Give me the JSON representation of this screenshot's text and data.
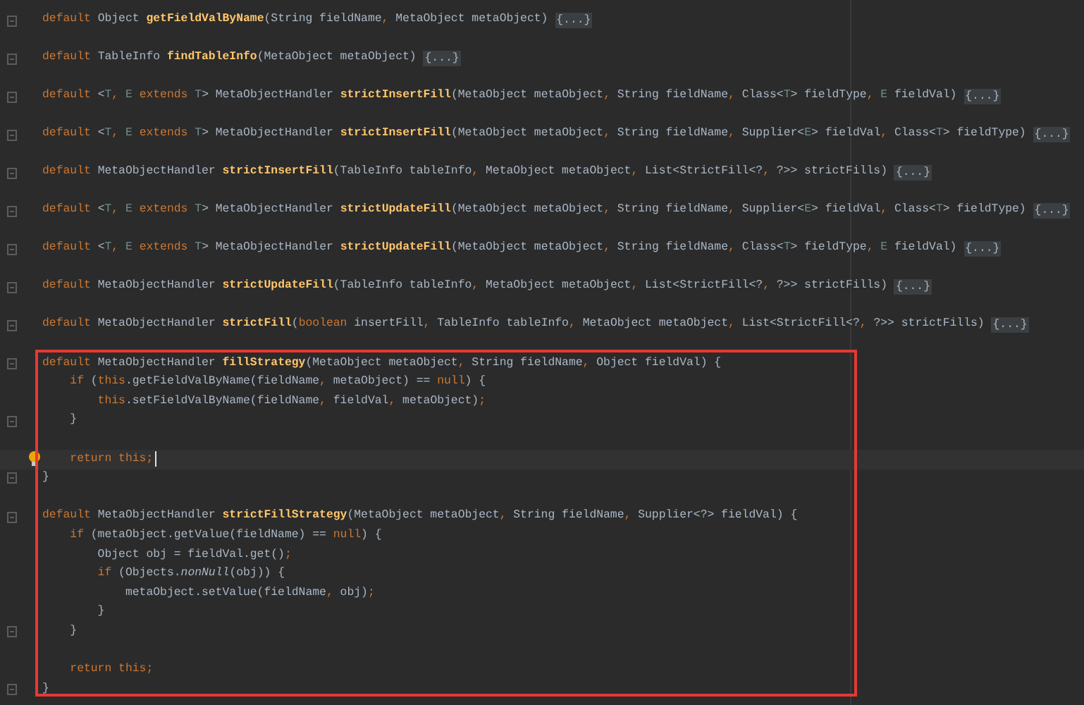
{
  "folded_methods": [
    {
      "tokens": [
        {
          "kind": "kw",
          "text": "default"
        },
        {
          "kind": "tx",
          "text": " Object "
        },
        {
          "kind": "fn",
          "text": "getFieldValByName"
        },
        {
          "kind": "tx",
          "text": "(String fieldName"
        },
        {
          "kind": "kw",
          "text": ","
        },
        {
          "kind": "tx",
          "text": " MetaObject metaObject)"
        }
      ],
      "folded": "{...}"
    },
    {
      "tokens": [
        {
          "kind": "kw",
          "text": "default"
        },
        {
          "kind": "tx",
          "text": " TableInfo "
        },
        {
          "kind": "fn",
          "text": "findTableInfo"
        },
        {
          "kind": "tx",
          "text": "(MetaObject metaObject)"
        }
      ],
      "folded": "{...}"
    },
    {
      "tokens": [
        {
          "kind": "kw",
          "text": "default"
        },
        {
          "kind": "tx",
          "text": " <"
        },
        {
          "kind": "tp",
          "text": "T"
        },
        {
          "kind": "kw",
          "text": ","
        },
        {
          "kind": "tp",
          "text": " E"
        },
        {
          "kind": "kw",
          "text": " extends "
        },
        {
          "kind": "tp",
          "text": "T"
        },
        {
          "kind": "tx",
          "text": "> MetaObjectHandler "
        },
        {
          "kind": "fn",
          "text": "strictInsertFill"
        },
        {
          "kind": "tx",
          "text": "(MetaObject metaObject"
        },
        {
          "kind": "kw",
          "text": ","
        },
        {
          "kind": "tx",
          "text": " String fieldName"
        },
        {
          "kind": "kw",
          "text": ","
        },
        {
          "kind": "tx",
          "text": " Class<"
        },
        {
          "kind": "tp",
          "text": "T"
        },
        {
          "kind": "tx",
          "text": "> fieldType"
        },
        {
          "kind": "kw",
          "text": ","
        },
        {
          "kind": "tp",
          "text": " E"
        },
        {
          "kind": "tx",
          "text": " fieldVal)"
        }
      ],
      "folded": "{...}"
    },
    {
      "tokens": [
        {
          "kind": "kw",
          "text": "default"
        },
        {
          "kind": "tx",
          "text": " <"
        },
        {
          "kind": "tp",
          "text": "T"
        },
        {
          "kind": "kw",
          "text": ","
        },
        {
          "kind": "tp",
          "text": " E"
        },
        {
          "kind": "kw",
          "text": " extends "
        },
        {
          "kind": "tp",
          "text": "T"
        },
        {
          "kind": "tx",
          "text": "> MetaObjectHandler "
        },
        {
          "kind": "fn",
          "text": "strictInsertFill"
        },
        {
          "kind": "tx",
          "text": "(MetaObject metaObject"
        },
        {
          "kind": "kw",
          "text": ","
        },
        {
          "kind": "tx",
          "text": " String fieldName"
        },
        {
          "kind": "kw",
          "text": ","
        },
        {
          "kind": "tx",
          "text": " Supplier<"
        },
        {
          "kind": "tp",
          "text": "E"
        },
        {
          "kind": "tx",
          "text": "> fieldVal"
        },
        {
          "kind": "kw",
          "text": ","
        },
        {
          "kind": "tx",
          "text": " Class<"
        },
        {
          "kind": "tp",
          "text": "T"
        },
        {
          "kind": "tx",
          "text": "> fieldType)"
        }
      ],
      "folded": "{...}"
    },
    {
      "tokens": [
        {
          "kind": "kw",
          "text": "default"
        },
        {
          "kind": "tx",
          "text": " MetaObjectHandler "
        },
        {
          "kind": "fn",
          "text": "strictInsertFill"
        },
        {
          "kind": "tx",
          "text": "(TableInfo tableInfo"
        },
        {
          "kind": "kw",
          "text": ","
        },
        {
          "kind": "tx",
          "text": " MetaObject metaObject"
        },
        {
          "kind": "kw",
          "text": ","
        },
        {
          "kind": "tx",
          "text": " List<StrictFill<?"
        },
        {
          "kind": "kw",
          "text": ","
        },
        {
          "kind": "tx",
          "text": " ?>> strictFills)"
        }
      ],
      "folded": "{...}"
    },
    {
      "tokens": [
        {
          "kind": "kw",
          "text": "default"
        },
        {
          "kind": "tx",
          "text": " <"
        },
        {
          "kind": "tp",
          "text": "T"
        },
        {
          "kind": "kw",
          "text": ","
        },
        {
          "kind": "tp",
          "text": " E"
        },
        {
          "kind": "kw",
          "text": " extends "
        },
        {
          "kind": "tp",
          "text": "T"
        },
        {
          "kind": "tx",
          "text": "> MetaObjectHandler "
        },
        {
          "kind": "fn",
          "text": "strictUpdateFill"
        },
        {
          "kind": "tx",
          "text": "(MetaObject metaObject"
        },
        {
          "kind": "kw",
          "text": ","
        },
        {
          "kind": "tx",
          "text": " String fieldName"
        },
        {
          "kind": "kw",
          "text": ","
        },
        {
          "kind": "tx",
          "text": " Supplier<"
        },
        {
          "kind": "tp",
          "text": "E"
        },
        {
          "kind": "tx",
          "text": "> fieldVal"
        },
        {
          "kind": "kw",
          "text": ","
        },
        {
          "kind": "tx",
          "text": " Class<"
        },
        {
          "kind": "tp",
          "text": "T"
        },
        {
          "kind": "tx",
          "text": "> fieldType)"
        }
      ],
      "folded": "{...}"
    },
    {
      "tokens": [
        {
          "kind": "kw",
          "text": "default"
        },
        {
          "kind": "tx",
          "text": " <"
        },
        {
          "kind": "tp",
          "text": "T"
        },
        {
          "kind": "kw",
          "text": ","
        },
        {
          "kind": "tp",
          "text": " E"
        },
        {
          "kind": "kw",
          "text": " extends "
        },
        {
          "kind": "tp",
          "text": "T"
        },
        {
          "kind": "tx",
          "text": "> MetaObjectHandler "
        },
        {
          "kind": "fn",
          "text": "strictUpdateFill"
        },
        {
          "kind": "tx",
          "text": "(MetaObject metaObject"
        },
        {
          "kind": "kw",
          "text": ","
        },
        {
          "kind": "tx",
          "text": " String fieldName"
        },
        {
          "kind": "kw",
          "text": ","
        },
        {
          "kind": "tx",
          "text": " Class<"
        },
        {
          "kind": "tp",
          "text": "T"
        },
        {
          "kind": "tx",
          "text": "> fieldType"
        },
        {
          "kind": "kw",
          "text": ","
        },
        {
          "kind": "tp",
          "text": " E"
        },
        {
          "kind": "tx",
          "text": " fieldVal)"
        }
      ],
      "folded": "{...}"
    },
    {
      "tokens": [
        {
          "kind": "kw",
          "text": "default"
        },
        {
          "kind": "tx",
          "text": " MetaObjectHandler "
        },
        {
          "kind": "fn",
          "text": "strictUpdateFill"
        },
        {
          "kind": "tx",
          "text": "(TableInfo tableInfo"
        },
        {
          "kind": "kw",
          "text": ","
        },
        {
          "kind": "tx",
          "text": " MetaObject metaObject"
        },
        {
          "kind": "kw",
          "text": ","
        },
        {
          "kind": "tx",
          "text": " List<StrictFill<?"
        },
        {
          "kind": "kw",
          "text": ","
        },
        {
          "kind": "tx",
          "text": " ?>> strictFills)"
        }
      ],
      "folded": "{...}"
    },
    {
      "tokens": [
        {
          "kind": "kw",
          "text": "default"
        },
        {
          "kind": "tx",
          "text": " MetaObjectHandler "
        },
        {
          "kind": "fn",
          "text": "strictFill"
        },
        {
          "kind": "tx",
          "text": "("
        },
        {
          "kind": "kw",
          "text": "boolean"
        },
        {
          "kind": "tx",
          "text": " insertFill"
        },
        {
          "kind": "kw",
          "text": ","
        },
        {
          "kind": "tx",
          "text": " TableInfo tableInfo"
        },
        {
          "kind": "kw",
          "text": ","
        },
        {
          "kind": "tx",
          "text": " MetaObject metaObject"
        },
        {
          "kind": "kw",
          "text": ","
        },
        {
          "kind": "tx",
          "text": " List<StrictFill<?"
        },
        {
          "kind": "kw",
          "text": ","
        },
        {
          "kind": "tx",
          "text": " ?>> strictFills)"
        }
      ],
      "folded": "{...}"
    }
  ],
  "highlighted_block": [
    {
      "kind": "code",
      "fold": true,
      "current": false,
      "tokens": [
        {
          "kind": "kw",
          "text": "default"
        },
        {
          "kind": "tx",
          "text": " MetaObjectHandler "
        },
        {
          "kind": "fn",
          "text": "fillStrategy"
        },
        {
          "kind": "tx",
          "text": "(MetaObject metaObject"
        },
        {
          "kind": "kw",
          "text": ","
        },
        {
          "kind": "tx",
          "text": " String fieldName"
        },
        {
          "kind": "kw",
          "text": ","
        },
        {
          "kind": "tx",
          "text": " Object fieldVal) {"
        }
      ]
    },
    {
      "kind": "code",
      "fold": false,
      "current": false,
      "tokens": [
        {
          "kind": "kw",
          "text": "    if"
        },
        {
          "kind": "tx",
          "text": " ("
        },
        {
          "kind": "kw",
          "text": "this"
        },
        {
          "kind": "tx",
          "text": ".getFieldValByName(fieldName"
        },
        {
          "kind": "kw",
          "text": ","
        },
        {
          "kind": "tx",
          "text": " metaObject) == "
        },
        {
          "kind": "kw",
          "text": "null"
        },
        {
          "kind": "tx",
          "text": ") {"
        }
      ]
    },
    {
      "kind": "code",
      "fold": false,
      "current": false,
      "tokens": [
        {
          "kind": "kw",
          "text": "        this"
        },
        {
          "kind": "tx",
          "text": ".setFieldValByName(fieldName"
        },
        {
          "kind": "kw",
          "text": ","
        },
        {
          "kind": "tx",
          "text": " fieldVal"
        },
        {
          "kind": "kw",
          "text": ","
        },
        {
          "kind": "tx",
          "text": " metaObject)"
        },
        {
          "kind": "kw",
          "text": ";"
        }
      ]
    },
    {
      "kind": "code",
      "fold": true,
      "current": false,
      "tokens": [
        {
          "kind": "tx",
          "text": "    }"
        }
      ]
    },
    {
      "kind": "blank",
      "fold": false,
      "current": false
    },
    {
      "kind": "code",
      "fold": false,
      "current": true,
      "tokens": [
        {
          "kind": "kw",
          "text": "    return this;"
        }
      ]
    },
    {
      "kind": "code",
      "fold": true,
      "current": false,
      "tokens": [
        {
          "kind": "tx",
          "text": "}"
        }
      ]
    },
    {
      "kind": "blank",
      "fold": false,
      "current": false
    },
    {
      "kind": "code",
      "fold": true,
      "current": false,
      "tokens": [
        {
          "kind": "kw",
          "text": "default"
        },
        {
          "kind": "tx",
          "text": " MetaObjectHandler "
        },
        {
          "kind": "fn",
          "text": "strictFillStrategy"
        },
        {
          "kind": "tx",
          "text": "(MetaObject metaObject"
        },
        {
          "kind": "kw",
          "text": ","
        },
        {
          "kind": "tx",
          "text": " String fieldName"
        },
        {
          "kind": "kw",
          "text": ","
        },
        {
          "kind": "tx",
          "text": " Supplier<?> fieldVal) {"
        }
      ]
    },
    {
      "kind": "code",
      "fold": false,
      "current": false,
      "tokens": [
        {
          "kind": "kw",
          "text": "    if"
        },
        {
          "kind": "tx",
          "text": " (metaObject.getValue(fieldName) == "
        },
        {
          "kind": "kw",
          "text": "null"
        },
        {
          "kind": "tx",
          "text": ") {"
        }
      ]
    },
    {
      "kind": "code",
      "fold": false,
      "current": false,
      "tokens": [
        {
          "kind": "tx",
          "text": "        Object obj = fieldVal.get()"
        },
        {
          "kind": "kw",
          "text": ";"
        }
      ]
    },
    {
      "kind": "code",
      "fold": false,
      "current": false,
      "tokens": [
        {
          "kind": "kw",
          "text": "        if"
        },
        {
          "kind": "tx",
          "text": " (Objects."
        },
        {
          "kind": "it",
          "text": "nonNull"
        },
        {
          "kind": "tx",
          "text": "(obj)) {"
        }
      ]
    },
    {
      "kind": "code",
      "fold": false,
      "current": false,
      "tokens": [
        {
          "kind": "tx",
          "text": "            metaObject.setValue(fieldName"
        },
        {
          "kind": "kw",
          "text": ","
        },
        {
          "kind": "tx",
          "text": " obj)"
        },
        {
          "kind": "kw",
          "text": ";"
        }
      ]
    },
    {
      "kind": "code",
      "fold": false,
      "current": false,
      "tokens": [
        {
          "kind": "tx",
          "text": "        }"
        }
      ]
    },
    {
      "kind": "code",
      "fold": true,
      "current": false,
      "tokens": [
        {
          "kind": "tx",
          "text": "    }"
        }
      ]
    },
    {
      "kind": "blank",
      "fold": false,
      "current": false
    },
    {
      "kind": "code",
      "fold": false,
      "current": false,
      "tokens": [
        {
          "kind": "kw",
          "text": "    return this;"
        }
      ]
    },
    {
      "kind": "code",
      "fold": true,
      "current": false,
      "tokens": [
        {
          "kind": "tx",
          "text": "}"
        }
      ]
    }
  ]
}
